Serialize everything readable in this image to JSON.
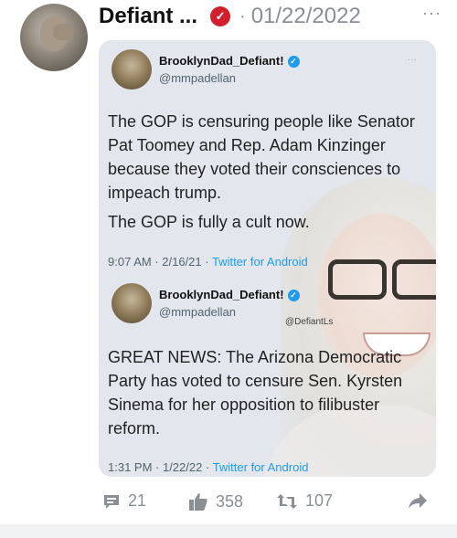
{
  "post": {
    "author_name": "Defiant ...",
    "separator": "·",
    "date": "01/22/2022",
    "more": "···"
  },
  "screenshot": {
    "tweet1": {
      "name": "BrooklynDad_Defiant!",
      "handle": "@mmpadellan",
      "paragraph1": "The GOP is censuring people like Senator Pat Toomey and Rep. Adam Kinzinger because they voted their consciences to impeach trump.",
      "paragraph2": "The GOP is fully a cult now.",
      "time_date": "9:07 AM · 2/16/21 · ",
      "source": "Twitter for Android",
      "more": "···"
    },
    "tweet2": {
      "name": "BrooklynDad_Defiant!",
      "handle": "@mmpadellan",
      "text": "GREAT NEWS: The Arizona Democratic Party has voted to censure Sen. Kyrsten Sinema for her opposition to filibuster reform.",
      "time_date": "1:31 PM · 1/22/22 · ",
      "source": "Twitter for Android"
    },
    "watermark": "@DefiantLs"
  },
  "actions": {
    "comments": "21",
    "likes": "358",
    "reposts": "107"
  },
  "colors": {
    "badge": "#d11f2e",
    "link": "#1d9bf0",
    "muted": "#8a8f96"
  }
}
